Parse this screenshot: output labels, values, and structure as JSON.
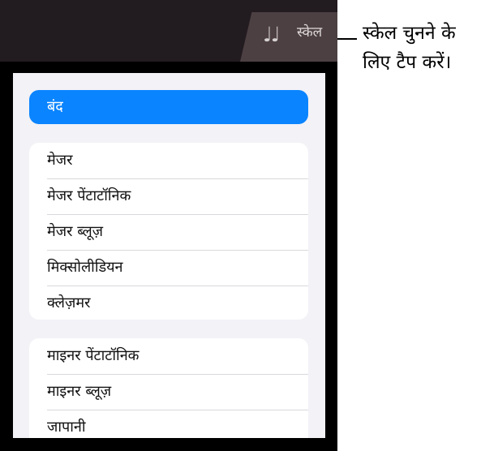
{
  "topbar": {
    "scale_icon": "♩♩",
    "scale_label": "स्केल"
  },
  "popover": {
    "off_label": "बंद",
    "major_group": [
      "मेजर",
      "मेजर पेंटाटॉनिक",
      "मेजर ब्लूज़",
      "मिक्सोलीडियन",
      "क्लेज़मर"
    ],
    "minor_group": [
      "माइनर पेंटाटॉनिक",
      "माइनर ब्लूज़",
      "जापानी"
    ]
  },
  "callout": {
    "text": "स्केल चुनने के लिए टैप करें।"
  },
  "colors": {
    "accent": "#0a84ff",
    "topbar": "#221b20",
    "tab": "#4d4043"
  },
  "icons": {
    "scale_icon": "music-notes-icon"
  }
}
